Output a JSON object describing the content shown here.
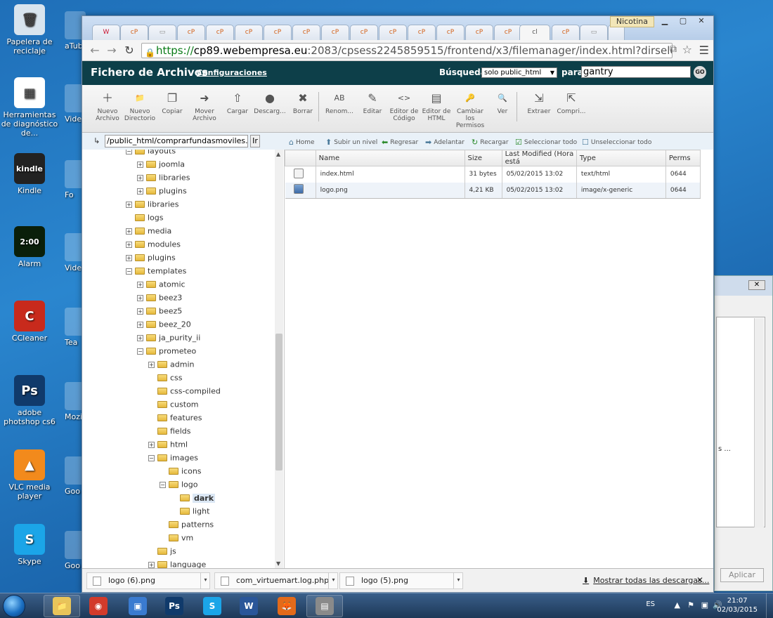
{
  "desktop": {
    "icons": [
      {
        "label": "Papelera de reciclaje",
        "glyph": "🗑",
        "bg": "#d8e4ee"
      },
      {
        "label": "Herramientas de diagnóstico de...",
        "glyph": "▦",
        "bg": "#ffffff"
      },
      {
        "label": "Kindle",
        "glyph": "kindle",
        "bg": "#222222"
      },
      {
        "label": "Alarm",
        "glyph": "2:00",
        "bg": "#0a1f0a"
      },
      {
        "label": "CCleaner",
        "glyph": "C",
        "bg": "#c82a1c"
      },
      {
        "label": "adobe photshop cs6",
        "glyph": "Ps",
        "bg": "#103a6b"
      },
      {
        "label": "VLC media player",
        "glyph": "▲",
        "bg": "#f28a1c"
      },
      {
        "label": "Skype",
        "glyph": "S",
        "bg": "#1ba5e8"
      }
    ],
    "col2": [
      "aTub",
      "Vide",
      "Fo",
      "Vide",
      "Tea",
      "Mozi",
      "Goo",
      "Goo"
    ]
  },
  "browser": {
    "tabs_label": "cP",
    "active_tab": "cl",
    "profile": "Nicotina",
    "url_https": "https://",
    "url_host": "cp89.webempresa.eu",
    "url_rest": ":2083/cpsess2245859515/frontend/x3/filemanager/index.html?dirselect=webroot&domains"
  },
  "cpanel": {
    "title": "Fichero de Archivos",
    "config_link": "Configuraciones",
    "search_label": "Búsqueda",
    "search_scope": "solo public_html",
    "para": "para",
    "search_value": "gantry",
    "go": "GO",
    "tools": [
      {
        "label": "Nuevo Archivo",
        "icon": "＋"
      },
      {
        "label": "Nuevo Directorio",
        "icon": "📁"
      },
      {
        "label": "Copiar",
        "icon": "❐"
      },
      {
        "label": "Mover Archivo",
        "icon": "➜"
      },
      {
        "label": "Cargar",
        "icon": "⇧"
      },
      {
        "label": "Descarg...",
        "icon": "●"
      },
      {
        "label": "Borrar",
        "icon": "✖"
      },
      {
        "label": "Renom...",
        "icon": "AB"
      },
      {
        "label": "Editar",
        "icon": "✎"
      },
      {
        "label": "Editor de Código",
        "icon": "<>"
      },
      {
        "label": "Editor de HTML",
        "icon": "▤"
      },
      {
        "label": "Cambiar los Permisos",
        "icon": "🔑"
      },
      {
        "label": "Ver",
        "icon": "🔍"
      },
      {
        "label": "Extraer",
        "icon": "⇲"
      },
      {
        "label": "Compri...",
        "icon": "⇱"
      }
    ],
    "path": "/public_html/comprarfundasmoviles.es/te",
    "path_go": "Ir",
    "actions": [
      {
        "label": "Home",
        "icon": "⌂"
      },
      {
        "label": "Subir un nivel",
        "icon": "⬆"
      },
      {
        "label": "Regresar",
        "icon": "⬅"
      },
      {
        "label": "Adelantar",
        "icon": "➡"
      },
      {
        "label": "Recargar",
        "icon": "↻"
      },
      {
        "label": "Seleccionar todo",
        "icon": "☑"
      },
      {
        "label": "Unseleccionar todo",
        "icon": "☐"
      }
    ],
    "columns": [
      "Name",
      "Size",
      "Last Modified (Hora está",
      "Type",
      "Perms"
    ],
    "files": [
      {
        "name": "index.html",
        "size": "31 bytes",
        "modified": "05/02/2015 13:02",
        "type": "text/html",
        "perms": "0644"
      },
      {
        "name": "logo.png",
        "size": "4,21 KB",
        "modified": "05/02/2015 13:02",
        "type": "image/x-generic",
        "perms": "0644"
      }
    ],
    "tree": [
      {
        "label": "layouts",
        "level": 0,
        "exp": "−"
      },
      {
        "label": "joomla",
        "level": 1,
        "exp": "+"
      },
      {
        "label": "libraries",
        "level": 1,
        "exp": "+"
      },
      {
        "label": "plugins",
        "level": 1,
        "exp": "+"
      },
      {
        "label": "libraries",
        "level": 0,
        "exp": "+"
      },
      {
        "label": "logs",
        "level": 0,
        "exp": ""
      },
      {
        "label": "media",
        "level": 0,
        "exp": "+"
      },
      {
        "label": "modules",
        "level": 0,
        "exp": "+"
      },
      {
        "label": "plugins",
        "level": 0,
        "exp": "+"
      },
      {
        "label": "templates",
        "level": 0,
        "exp": "−"
      },
      {
        "label": "atomic",
        "level": 1,
        "exp": "+"
      },
      {
        "label": "beez3",
        "level": 1,
        "exp": "+"
      },
      {
        "label": "beez5",
        "level": 1,
        "exp": "+"
      },
      {
        "label": "beez_20",
        "level": 1,
        "exp": "+"
      },
      {
        "label": "ja_purity_ii",
        "level": 1,
        "exp": "+"
      },
      {
        "label": "prometeo",
        "level": 1,
        "exp": "−"
      },
      {
        "label": "admin",
        "level": 2,
        "exp": "+"
      },
      {
        "label": "css",
        "level": 2,
        "exp": ""
      },
      {
        "label": "css-compiled",
        "level": 2,
        "exp": ""
      },
      {
        "label": "custom",
        "level": 2,
        "exp": ""
      },
      {
        "label": "features",
        "level": 2,
        "exp": ""
      },
      {
        "label": "fields",
        "level": 2,
        "exp": ""
      },
      {
        "label": "html",
        "level": 2,
        "exp": "+"
      },
      {
        "label": "images",
        "level": 2,
        "exp": "−"
      },
      {
        "label": "icons",
        "level": 3,
        "exp": ""
      },
      {
        "label": "logo",
        "level": 3,
        "exp": "−"
      },
      {
        "label": "dark",
        "level": 4,
        "exp": "",
        "selected": true
      },
      {
        "label": "light",
        "level": 4,
        "exp": ""
      },
      {
        "label": "patterns",
        "level": 3,
        "exp": ""
      },
      {
        "label": "vm",
        "level": 3,
        "exp": ""
      },
      {
        "label": "js",
        "level": 2,
        "exp": ""
      },
      {
        "label": "language",
        "level": 2,
        "exp": "+"
      }
    ]
  },
  "downloads": {
    "items": [
      "logo (6).png",
      "com_virtuemart.log.php",
      "logo (5).png"
    ],
    "show_all": "Mostrar todas las descargas...",
    "close": "✕"
  },
  "bgwindow": {
    "partial_text": "s ...",
    "apply": "Aplicar"
  },
  "taskbar": {
    "apps": [
      {
        "name": "explorer",
        "glyph": "📁",
        "bg": "#e8c45a"
      },
      {
        "name": "chrome",
        "glyph": "◉",
        "bg": "#d23b2b"
      },
      {
        "name": "apps",
        "glyph": "▣",
        "bg": "#3a7bd0"
      },
      {
        "name": "photoshop",
        "glyph": "Ps",
        "bg": "#103a6b"
      },
      {
        "name": "skype",
        "glyph": "S",
        "bg": "#1ba5e8"
      },
      {
        "name": "word",
        "glyph": "W",
        "bg": "#2a5699"
      },
      {
        "name": "firefox",
        "glyph": "🦊",
        "bg": "#e36a1a"
      },
      {
        "name": "other",
        "glyph": "▤",
        "bg": "#8a8a8a"
      }
    ],
    "lang": "ES",
    "time": "21:07",
    "date": "02/03/2015"
  }
}
